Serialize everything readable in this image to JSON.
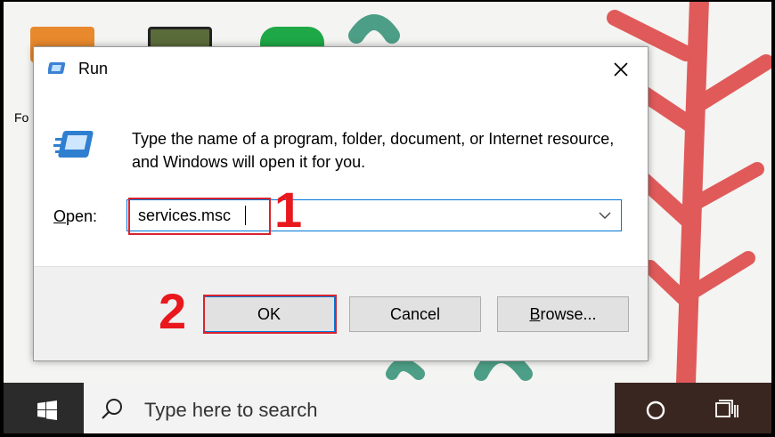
{
  "desktop": {
    "partial_label": "Fo"
  },
  "dialog": {
    "title": "Run",
    "close_glyph": "✕",
    "instructions": "Type the name of a program, folder, document, or Internet resource, and Windows will open it for you.",
    "open_label_accel": "O",
    "open_label_rest": "pen:",
    "input_value": "services.msc",
    "buttons": {
      "ok": "OK",
      "cancel": "Cancel",
      "browse_accel": "B",
      "browse_rest": "rowse..."
    }
  },
  "annotations": {
    "step1": "1",
    "step2": "2",
    "highlight_color": "#d9232d",
    "number_color": "#e8181d"
  },
  "taskbar": {
    "search_placeholder": "Type here to search"
  },
  "icons": {
    "run": "run-icon",
    "close": "close-icon",
    "dropdown": "chevron-down-icon",
    "start": "windows-start-icon",
    "search": "search-icon",
    "cortana": "cortana-circle-icon",
    "taskview": "task-view-icon"
  }
}
